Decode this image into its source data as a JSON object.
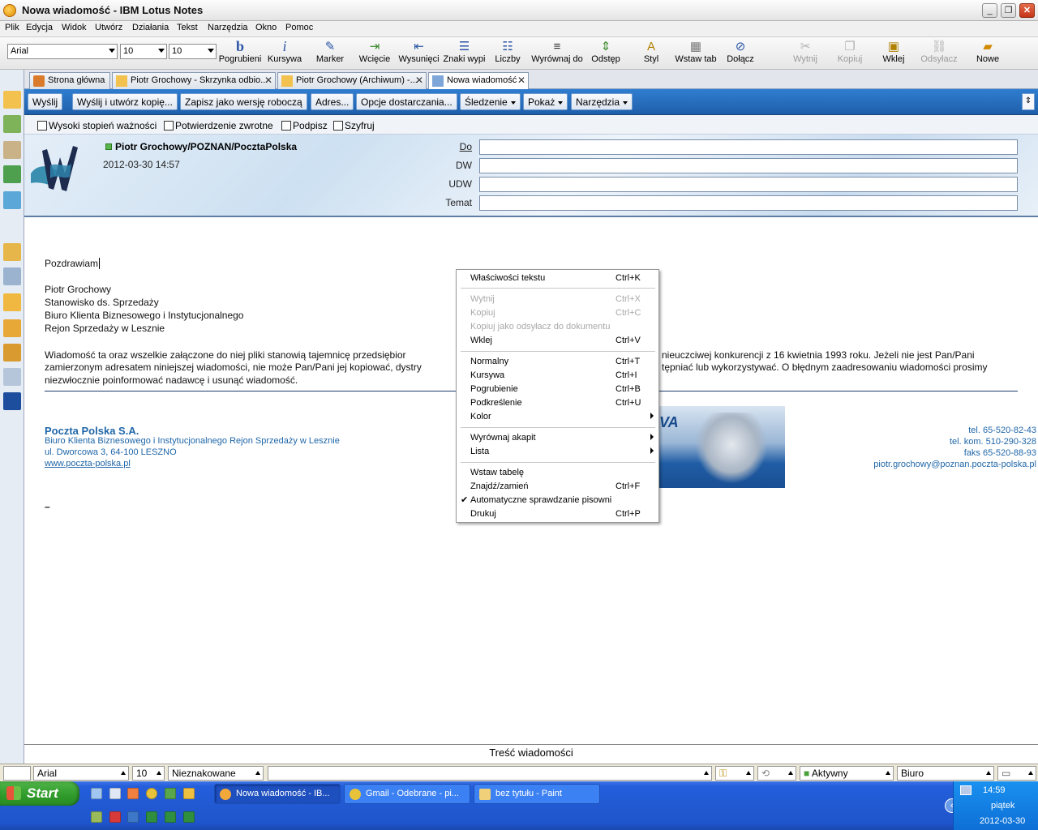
{
  "window": {
    "title": "Nowa wiadomość - IBM Lotus Notes"
  },
  "menu": [
    "Plik",
    "Edycja",
    "Widok",
    "Utwórz",
    "Działania",
    "Tekst",
    "Narzędzia",
    "Okno",
    "Pomoc"
  ],
  "toolbar": {
    "font": "Arial",
    "size1": "10",
    "size2": "10",
    "buttons": {
      "bold": "Pogrubieni",
      "italic": "Kursywa",
      "marker": "Marker",
      "indent": "Wcięcie",
      "outdent": "Wysunięci",
      "bullets": "Znaki wypi",
      "numbers": "Liczby",
      "align": "Wyrównaj do",
      "spacing": "Odstęp",
      "style": "Styl",
      "tab": "Wstaw tab",
      "attach": "Dołącz",
      "cut": "Wytnij",
      "copy": "Kopiuj",
      "paste": "Wklej",
      "link": "Odsyłacz",
      "new": "Nowe"
    }
  },
  "tabs": [
    {
      "label": "Strona główna"
    },
    {
      "label": "Piotr Grochowy - Skrzynka odbio..."
    },
    {
      "label": "Piotr Grochowy (Archiwum) -..."
    },
    {
      "label": "Nowa wiadomość"
    }
  ],
  "actions": {
    "send": "Wyślij",
    "send_copy": "Wyślij i utwórz kopię...",
    "save_draft": "Zapisz jako wersję roboczą",
    "address": "Adres...",
    "delivery": "Opcje dostarczania...",
    "tracking": "Śledzenie",
    "show": "Pokaż",
    "tools": "Narzędzia"
  },
  "options": {
    "priority": "Wysoki stopień ważności",
    "receipt": "Potwierdzenie zwrotne",
    "sign": "Podpisz",
    "encrypt": "Szyfruj"
  },
  "header": {
    "sender": "Piotr Grochowy/POZNAN/PocztaPolska",
    "date": "2012-03-30 14:57",
    "to_label": "Do",
    "cc_label": "DW",
    "bcc_label": "UDW",
    "subject_label": "Temat"
  },
  "body": {
    "greeting": "Pozdrawiam",
    "sig_name": "Piotr Grochowy",
    "sig_role": "Stanowisko ds. Sprzedaży",
    "sig_dept": "Biuro Klienta Biznesowego i Instytucjonalnego",
    "sig_region": "Rejon Sprzedaży w Lesznie",
    "disclaimer_a": "Wiadomość ta oraz wszelkie załączone do niej pliki stanowią tajemnicę przedsiębior",
    "disclaimer_b": "nieuczciwej konkurencji z 16 kwietnia 1993 roku. Jeżeli nie jest Pan/Pani",
    "disclaimer_c": "zamierzonym adresatem niniejszej wiadomości, nie może Pan/Pani jej kopiować, dystry",
    "disclaimer_d": "tępniać lub wykorzystywać. O błędnym zaadresowaniu wiadomości prosimy",
    "disclaimer_e": "niezwłocznie poinformować nadawcę i usunąć wiadomość.",
    "company": "Poczta Polska S.A.",
    "company_dept": "Biuro Klienta Biznesowego i Instytucjonalnego Rejon Sprzedaży w Lesznie",
    "company_addr": "ul. Dworcowa 3, 64-100 LESZNO",
    "company_www": "www.poczta-polska.pl",
    "banner_text": "VA",
    "tel": "tel. 65-520-82-43",
    "mobile": "tel. kom. 510-290-328",
    "fax": "faks 65-520-88-93",
    "email": "piotr.grochowy@poznan.poczta-polska.pl",
    "cursor_mark": "–"
  },
  "context_menu": [
    {
      "label": "Właściwości tekstu",
      "shortcut": "Ctrl+K"
    },
    {
      "label": "Wytnij",
      "shortcut": "Ctrl+X",
      "disabled": true
    },
    {
      "label": "Kopiuj",
      "shortcut": "Ctrl+C",
      "disabled": true
    },
    {
      "label": "Kopiuj jako odsyłacz do dokumentu",
      "shortcut": "",
      "disabled": true
    },
    {
      "label": "Wklej",
      "shortcut": "Ctrl+V"
    },
    {
      "label": "Normalny",
      "shortcut": "Ctrl+T"
    },
    {
      "label": "Kursywa",
      "shortcut": "Ctrl+I"
    },
    {
      "label": "Pogrubienie",
      "shortcut": "Ctrl+B"
    },
    {
      "label": "Podkreślenie",
      "shortcut": "Ctrl+U"
    },
    {
      "label": "Kolor",
      "shortcut": "",
      "submenu": true
    },
    {
      "label": "Wyrównaj akapit",
      "shortcut": "",
      "submenu": true
    },
    {
      "label": "Lista",
      "shortcut": "",
      "submenu": true
    },
    {
      "label": "Wstaw tabelę",
      "shortcut": ""
    },
    {
      "label": "Znajdź/zamień",
      "shortcut": "Ctrl+F"
    },
    {
      "label": "Automatyczne sprawdzanie pisowni",
      "shortcut": "",
      "checked": true
    },
    {
      "label": "Drukuj",
      "shortcut": "Ctrl+P"
    }
  ],
  "content_area_label": "Treść wiadomości",
  "statusbar": {
    "font": "Arial",
    "size": "10",
    "style": "Nieznakowane",
    "status": "Aktywny",
    "location": "Biuro"
  },
  "taskbar": {
    "start": "Start",
    "tasks": [
      "Nowa wiadomość - IB...",
      "Gmail - Odebrane - pi...",
      "bez tytułu - Paint"
    ],
    "time": "14:59",
    "day": "piątek",
    "date": "2012-03-30"
  },
  "colors": {
    "action_bar": "#2f7dd0",
    "link_blue": "#1f66a8",
    "taskbar": "#245edb",
    "start_green": "#2f9a2a"
  }
}
